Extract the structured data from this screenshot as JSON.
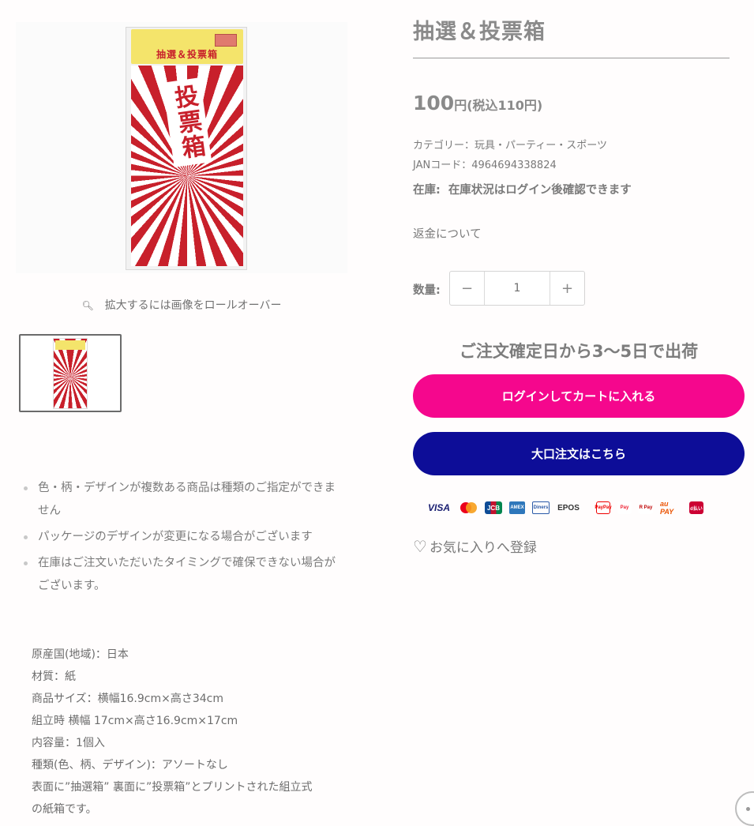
{
  "product": {
    "title": "抽選＆投票箱",
    "price_amount": "100",
    "price_unit": "円(税込110円)",
    "category": "カテゴリー：玩具・パーティー・スポーツ",
    "jan": "JANコード：4964694338824",
    "stock_label": "在庫:",
    "stock_value": "在庫状況はログイン後確認できます",
    "refund_link": "返金について",
    "quantity_label": "数量:",
    "quantity_value": "1",
    "delivery_note": "ご注文確定日から3〜5日で出荷",
    "cart_button": "ログインしてカートに入れる",
    "bulk_button": "大口注文はこちら",
    "favorite": "お気に入りへ登録"
  },
  "gallery": {
    "package_header_title": "抽選＆投票箱",
    "package_body_text": "投票箱",
    "zoom_hint": "拡大するには画像をロールオーバー"
  },
  "notes": [
    "色・柄・デザインが複数ある商品は種類のご指定ができません",
    "パッケージのデザインが変更になる場合がございます",
    "在庫はご注文いただいたタイミングで確保できない場合がございます。"
  ],
  "specs": [
    "原産国(地域)：日本",
    "材質：紙",
    "商品サイズ：横幅16.9cm×高さ34cm",
    "組立時 横幅 17cm×高さ16.9cm×17cm",
    "内容量：1個入",
    "種類(色、柄、デザイン)：アソートなし",
    "表面に”抽選箱” 裏面に”投票箱”とプリントされた組立式",
    "の紙箱です。"
  ],
  "payments": {
    "visa": "VISA",
    "jcb": "JCB",
    "amex": "AMEX",
    "diners": "Diners",
    "epos": "EPOS",
    "paypay": "PayPay",
    "merpay": "Pay",
    "rpay": "R Pay",
    "aupay": "au PAY",
    "dpay": "d払い"
  },
  "colors": {
    "cart_button": "#f5078d",
    "bulk_button": "#0d0d98",
    "package_red": "#c8202b"
  }
}
